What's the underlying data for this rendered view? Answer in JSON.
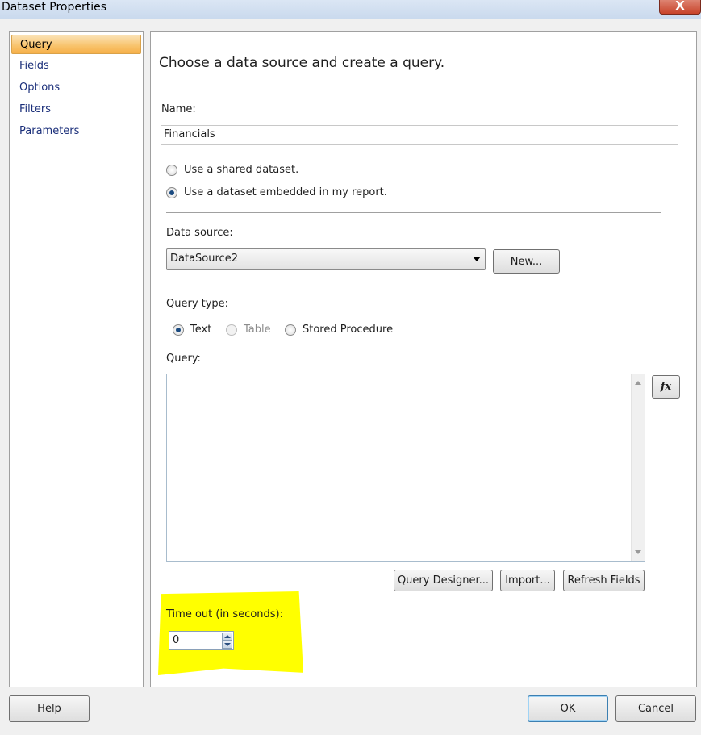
{
  "window": {
    "title": "Dataset Properties",
    "close_glyph": "X"
  },
  "nav": {
    "items": [
      {
        "label": "Query",
        "selected": true
      },
      {
        "label": "Fields",
        "selected": false
      },
      {
        "label": "Options",
        "selected": false
      },
      {
        "label": "Filters",
        "selected": false
      },
      {
        "label": "Parameters",
        "selected": false
      }
    ]
  },
  "main": {
    "heading": "Choose a data source and create a query.",
    "name_label": "Name:",
    "name_value": "Financials",
    "dataset_options": [
      {
        "label": "Use a shared dataset.",
        "checked": false
      },
      {
        "label": "Use a dataset embedded in my report.",
        "checked": true
      }
    ],
    "data_source_label": "Data source:",
    "data_source_value": "DataSource2",
    "new_button": "New...",
    "query_type_label": "Query type:",
    "query_types": [
      {
        "label": "Text",
        "checked": true,
        "disabled": false
      },
      {
        "label": "Table",
        "checked": false,
        "disabled": true
      },
      {
        "label": "Stored Procedure",
        "checked": false,
        "disabled": false
      }
    ],
    "query_label": "Query:",
    "query_text": "",
    "fx_button": "fx",
    "query_designer_button": "Query Designer...",
    "import_button": "Import...",
    "refresh_fields_button": "Refresh Fields",
    "timeout_label": "Time out (in seconds):",
    "timeout_value": "0"
  },
  "footer": {
    "help_button": "Help",
    "ok_button": "OK",
    "cancel_button": "Cancel"
  },
  "colors": {
    "highlight": "#ffff00",
    "nav_selected": "#f8c26a",
    "nav_text": "#1b2f7a"
  }
}
